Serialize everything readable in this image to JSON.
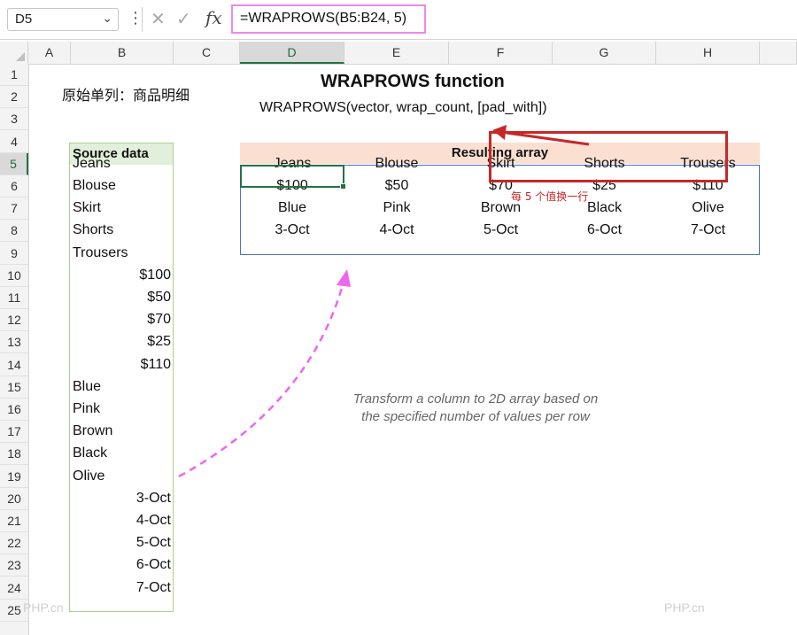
{
  "formula_bar": {
    "name_box": "D5",
    "cancel_icon": "✕",
    "enter_icon": "✓",
    "fx_label": "fx",
    "formula": "=WRAPROWS(B5:B24, 5)"
  },
  "columns": [
    "A",
    "B",
    "C",
    "D",
    "E",
    "F",
    "G",
    "H"
  ],
  "selected_column": "D",
  "rows": [
    "1",
    "2",
    "3",
    "4",
    "5",
    "6",
    "7",
    "8",
    "9",
    "10",
    "11",
    "12",
    "13",
    "14",
    "15",
    "16",
    "17",
    "18",
    "19",
    "20",
    "21",
    "22",
    "23",
    "24",
    "25"
  ],
  "selected_row": "5",
  "sheet": {
    "title": "WRAPROWS function",
    "syntax": "WRAPROWS(vector, wrap_count, [pad_with])",
    "chinese_label": "原始单列：商品明细",
    "source_header": "Source data",
    "source_text": [
      "Jeans",
      "Blouse",
      "Skirt",
      "Shorts",
      "Trousers"
    ],
    "source_prices": [
      "$100",
      "$50",
      "$70",
      "$25",
      "$110"
    ],
    "source_colors": [
      "Blue",
      "Pink",
      "Brown",
      "Black",
      "Olive"
    ],
    "source_dates": [
      "3-Oct",
      "4-Oct",
      "5-Oct",
      "6-Oct",
      "7-Oct"
    ],
    "result_header": "Resulting array",
    "result_rows": [
      [
        "Jeans",
        "Blouse",
        "Skirt",
        "Shorts",
        "Trousers"
      ],
      [
        "$100",
        "$50",
        "$70",
        "$25",
        "$110"
      ],
      [
        "Blue",
        "Pink",
        "Brown",
        "Black",
        "Olive"
      ],
      [
        "3-Oct",
        "4-Oct",
        "5-Oct",
        "6-Oct",
        "7-Oct"
      ]
    ],
    "note_line1": "Transform a column to 2D array based on",
    "note_line2": "the specified number of values per row"
  },
  "annotation": {
    "text": "每 5 个值换一行",
    "color": "#c62828"
  },
  "watermarks": [
    "PHP.cn",
    "PHP.cn"
  ],
  "colors": {
    "excel_green": "#217346",
    "source_header_bg": "#e2efda",
    "result_header_bg": "#fbe0d2",
    "result_border": "#4a72c4",
    "arrow_pink": "#ee66ee"
  }
}
